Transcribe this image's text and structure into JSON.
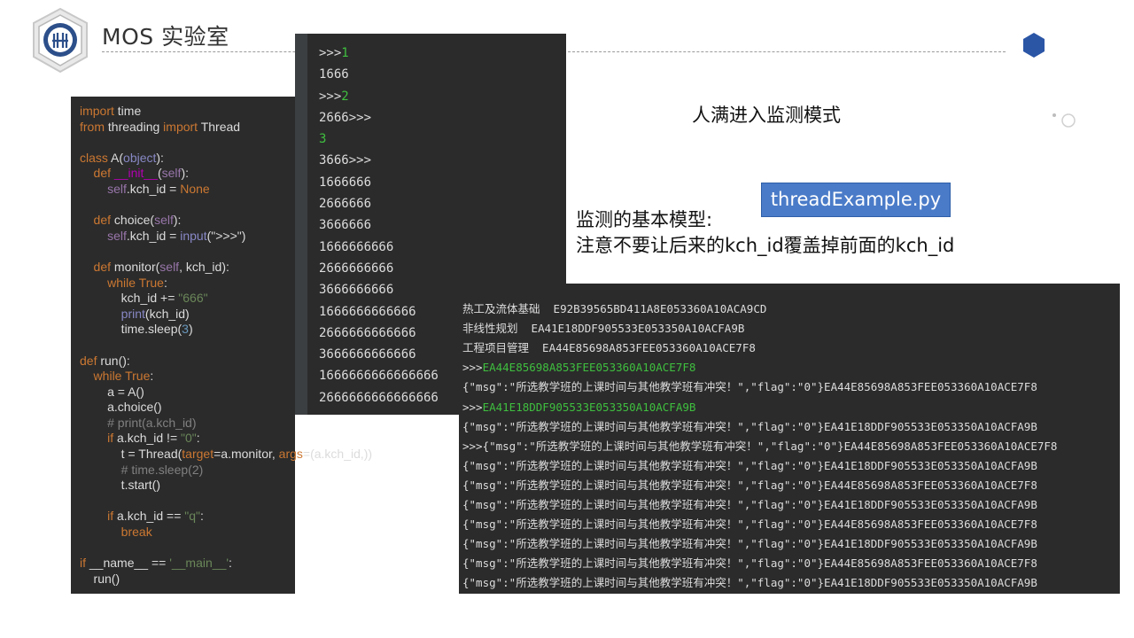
{
  "header": {
    "title": "MOS 实验室"
  },
  "code_editor": {
    "lines": [
      [
        {
          "t": "import",
          "c": "k"
        },
        {
          "t": " time",
          "c": "w"
        }
      ],
      [
        {
          "t": "from",
          "c": "k"
        },
        {
          "t": " threading ",
          "c": "w"
        },
        {
          "t": "import",
          "c": "k"
        },
        {
          "t": " Thread",
          "c": "w"
        }
      ],
      [],
      [
        {
          "t": "class",
          "c": "k"
        },
        {
          "t": " A(",
          "c": "w"
        },
        {
          "t": "object",
          "c": "b"
        },
        {
          "t": "):",
          "c": "w"
        }
      ],
      [
        {
          "t": "    def ",
          "c": "k"
        },
        {
          "t": "__init__",
          "c": "m"
        },
        {
          "t": "(",
          "c": "w"
        },
        {
          "t": "self",
          "c": "p"
        },
        {
          "t": "):",
          "c": "w"
        }
      ],
      [
        {
          "t": "        self",
          "c": "p"
        },
        {
          "t": ".kch_id = ",
          "c": "w"
        },
        {
          "t": "None",
          "c": "k"
        }
      ],
      [],
      [
        {
          "t": "    def ",
          "c": "k"
        },
        {
          "t": "choice",
          "c": "w"
        },
        {
          "t": "(",
          "c": "w"
        },
        {
          "t": "self",
          "c": "p"
        },
        {
          "t": "):",
          "c": "w"
        }
      ],
      [
        {
          "t": "        self",
          "c": "p"
        },
        {
          "t": ".kch_id = ",
          "c": "w"
        },
        {
          "t": "input",
          "c": "b"
        },
        {
          "t": "(\">>>\")",
          "c": "w"
        }
      ],
      [],
      [
        {
          "t": "    def ",
          "c": "k"
        },
        {
          "t": "monitor",
          "c": "w"
        },
        {
          "t": "(",
          "c": "w"
        },
        {
          "t": "self",
          "c": "p"
        },
        {
          "t": ", kch_id):",
          "c": "w"
        }
      ],
      [
        {
          "t": "        while ",
          "c": "k"
        },
        {
          "t": "True",
          "c": "k"
        },
        {
          "t": ":",
          "c": "w"
        }
      ],
      [
        {
          "t": "            kch_id += ",
          "c": "w"
        },
        {
          "t": "\"666\"",
          "c": "s"
        }
      ],
      [
        {
          "t": "            print",
          "c": "b"
        },
        {
          "t": "(kch_id)",
          "c": "w"
        }
      ],
      [
        {
          "t": "            time.sleep(",
          "c": "w"
        },
        {
          "t": "3",
          "c": "n"
        },
        {
          "t": ")",
          "c": "w"
        }
      ],
      [],
      [
        {
          "t": "def ",
          "c": "k"
        },
        {
          "t": "run",
          "c": "w"
        },
        {
          "t": "():",
          "c": "w"
        }
      ],
      [
        {
          "t": "    while ",
          "c": "k"
        },
        {
          "t": "True",
          "c": "k"
        },
        {
          "t": ":",
          "c": "w"
        }
      ],
      [
        {
          "t": "        a = A()",
          "c": "w"
        }
      ],
      [
        {
          "t": "        a.choice()",
          "c": "w"
        }
      ],
      [
        {
          "t": "        # print(a.kch_id)",
          "c": "c"
        }
      ],
      [
        {
          "t": "        if ",
          "c": "k"
        },
        {
          "t": "a.kch_id != ",
          "c": "w"
        },
        {
          "t": "\"0\"",
          "c": "s"
        },
        {
          "t": ":",
          "c": "w"
        }
      ],
      [
        {
          "t": "            t = Thread(",
          "c": "w"
        },
        {
          "t": "target",
          "c": "k"
        },
        {
          "t": "=a.monitor, ",
          "c": "w"
        },
        {
          "t": "args",
          "c": "k"
        },
        {
          "t": "=(a.kch_id,))",
          "c": "w"
        }
      ],
      [
        {
          "t": "            # time.sleep(2)",
          "c": "c"
        }
      ],
      [
        {
          "t": "            t.start()",
          "c": "w"
        }
      ],
      [],
      [
        {
          "t": "        if ",
          "c": "k"
        },
        {
          "t": "a.kch_id == ",
          "c": "w"
        },
        {
          "t": "\"q\"",
          "c": "s"
        },
        {
          "t": ":",
          "c": "w"
        }
      ],
      [
        {
          "t": "            break",
          "c": "k"
        }
      ],
      [],
      [
        {
          "t": "if ",
          "c": "k"
        },
        {
          "t": "__name__ == ",
          "c": "w"
        },
        {
          "t": "'__main__'",
          "c": "s"
        },
        {
          "t": ":",
          "c": "w"
        }
      ],
      [
        {
          "t": "    run()",
          "c": "w"
        }
      ]
    ]
  },
  "console_top": {
    "lines": [
      [
        {
          "t": ">>>",
          "c": "w"
        },
        {
          "t": "1",
          "c": "g"
        }
      ],
      [
        {
          "t": "1666",
          "c": "w"
        }
      ],
      [
        {
          "t": ">>>",
          "c": "w"
        },
        {
          "t": "2",
          "c": "g"
        }
      ],
      [
        {
          "t": "2666>>>",
          "c": "w"
        }
      ],
      [
        {
          "t": "3",
          "c": "g"
        }
      ],
      [
        {
          "t": "3666>>>",
          "c": "w"
        }
      ],
      [
        {
          "t": "1666666",
          "c": "w"
        }
      ],
      [
        {
          "t": "2666666",
          "c": "w"
        }
      ],
      [
        {
          "t": "3666666",
          "c": "w"
        }
      ],
      [
        {
          "t": "1666666666",
          "c": "w"
        }
      ],
      [
        {
          "t": "2666666666",
          "c": "w"
        }
      ],
      [
        {
          "t": "3666666666",
          "c": "w"
        }
      ],
      [
        {
          "t": "1666666666666",
          "c": "w"
        }
      ],
      [
        {
          "t": "2666666666666",
          "c": "w"
        }
      ],
      [
        {
          "t": "3666666666666",
          "c": "w"
        }
      ],
      [
        {
          "t": "1666666666666666",
          "c": "w"
        }
      ],
      [
        {
          "t": "2666666666666666",
          "c": "w"
        }
      ]
    ]
  },
  "console_bottom": {
    "lines": [
      [
        {
          "t": "热工及流体基础  E92B39565BD411A8E053360A10ACA9CD",
          "c": "w"
        }
      ],
      [
        {
          "t": "非线性规划  EA41E18DDF905533E053350A10ACFA9B",
          "c": "w"
        }
      ],
      [
        {
          "t": "工程项目管理  EA44E85698A853FEE053360A10ACE7F8",
          "c": "w"
        }
      ],
      [
        {
          "t": ">>>",
          "c": "w"
        },
        {
          "t": "EA44E85698A853FEE053360A10ACE7F8",
          "c": "gl"
        }
      ],
      [
        {
          "t": "{\"msg\":\"所选教学班的上课时间与其他教学班有冲突！\",\"flag\":\"0\"}EA44E85698A853FEE053360A10ACE7F8",
          "c": "w"
        }
      ],
      [
        {
          "t": ">>>",
          "c": "w"
        },
        {
          "t": "EA41E18DDF905533E053350A10ACFA9B",
          "c": "gl"
        }
      ],
      [
        {
          "t": "{\"msg\":\"所选教学班的上课时间与其他教学班有冲突！\",\"flag\":\"0\"}EA41E18DDF905533E053350A10ACFA9B",
          "c": "w"
        }
      ],
      [
        {
          "t": ">>>{\"msg\":\"所选教学班的上课时间与其他教学班有冲突！\",\"flag\":\"0\"}EA44E85698A853FEE053360A10ACE7F8",
          "c": "w"
        }
      ],
      [
        {
          "t": "{\"msg\":\"所选教学班的上课时间与其他教学班有冲突！\",\"flag\":\"0\"}EA41E18DDF905533E053350A10ACFA9B",
          "c": "w"
        }
      ],
      [
        {
          "t": "{\"msg\":\"所选教学班的上课时间与其他教学班有冲突！\",\"flag\":\"0\"}EA44E85698A853FEE053360A10ACE7F8",
          "c": "w"
        }
      ],
      [
        {
          "t": "{\"msg\":\"所选教学班的上课时间与其他教学班有冲突！\",\"flag\":\"0\"}EA41E18DDF905533E053350A10ACFA9B",
          "c": "w"
        }
      ],
      [
        {
          "t": "{\"msg\":\"所选教学班的上课时间与其他教学班有冲突！\",\"flag\":\"0\"}EA44E85698A853FEE053360A10ACE7F8",
          "c": "w"
        }
      ],
      [
        {
          "t": "{\"msg\":\"所选教学班的上课时间与其他教学班有冲突！\",\"flag\":\"0\"}EA41E18DDF905533E053350A10ACFA9B",
          "c": "w"
        }
      ],
      [
        {
          "t": "{\"msg\":\"所选教学班的上课时间与其他教学班有冲突！\",\"flag\":\"0\"}EA44E85698A853FEE053360A10ACE7F8",
          "c": "w"
        }
      ],
      [
        {
          "t": "{\"msg\":\"所选教学班的上课时间与其他教学班有冲突！\",\"flag\":\"0\"}EA41E18DDF905533E053350A10ACFA9B",
          "c": "w"
        }
      ]
    ]
  },
  "annotations": {
    "monitor_mode": "人满进入监测模式",
    "model_title": "监测的基本模型:",
    "model_note": "注意不要让后来的kch_id覆盖掉前面的kch_id"
  },
  "file_button": {
    "label": "threadExample.py",
    "color": "#4a7bc8"
  },
  "colors": {
    "editor_bg": "#2b2b2b",
    "keyword": "#cc7832",
    "string": "#6a8759",
    "console_input": "#3fbf3f",
    "underline_mark": "#3fbf3f"
  },
  "icons": [
    "shield-logo-icon",
    "hexagon-badge-icon",
    "decorative-dots-icon"
  ]
}
